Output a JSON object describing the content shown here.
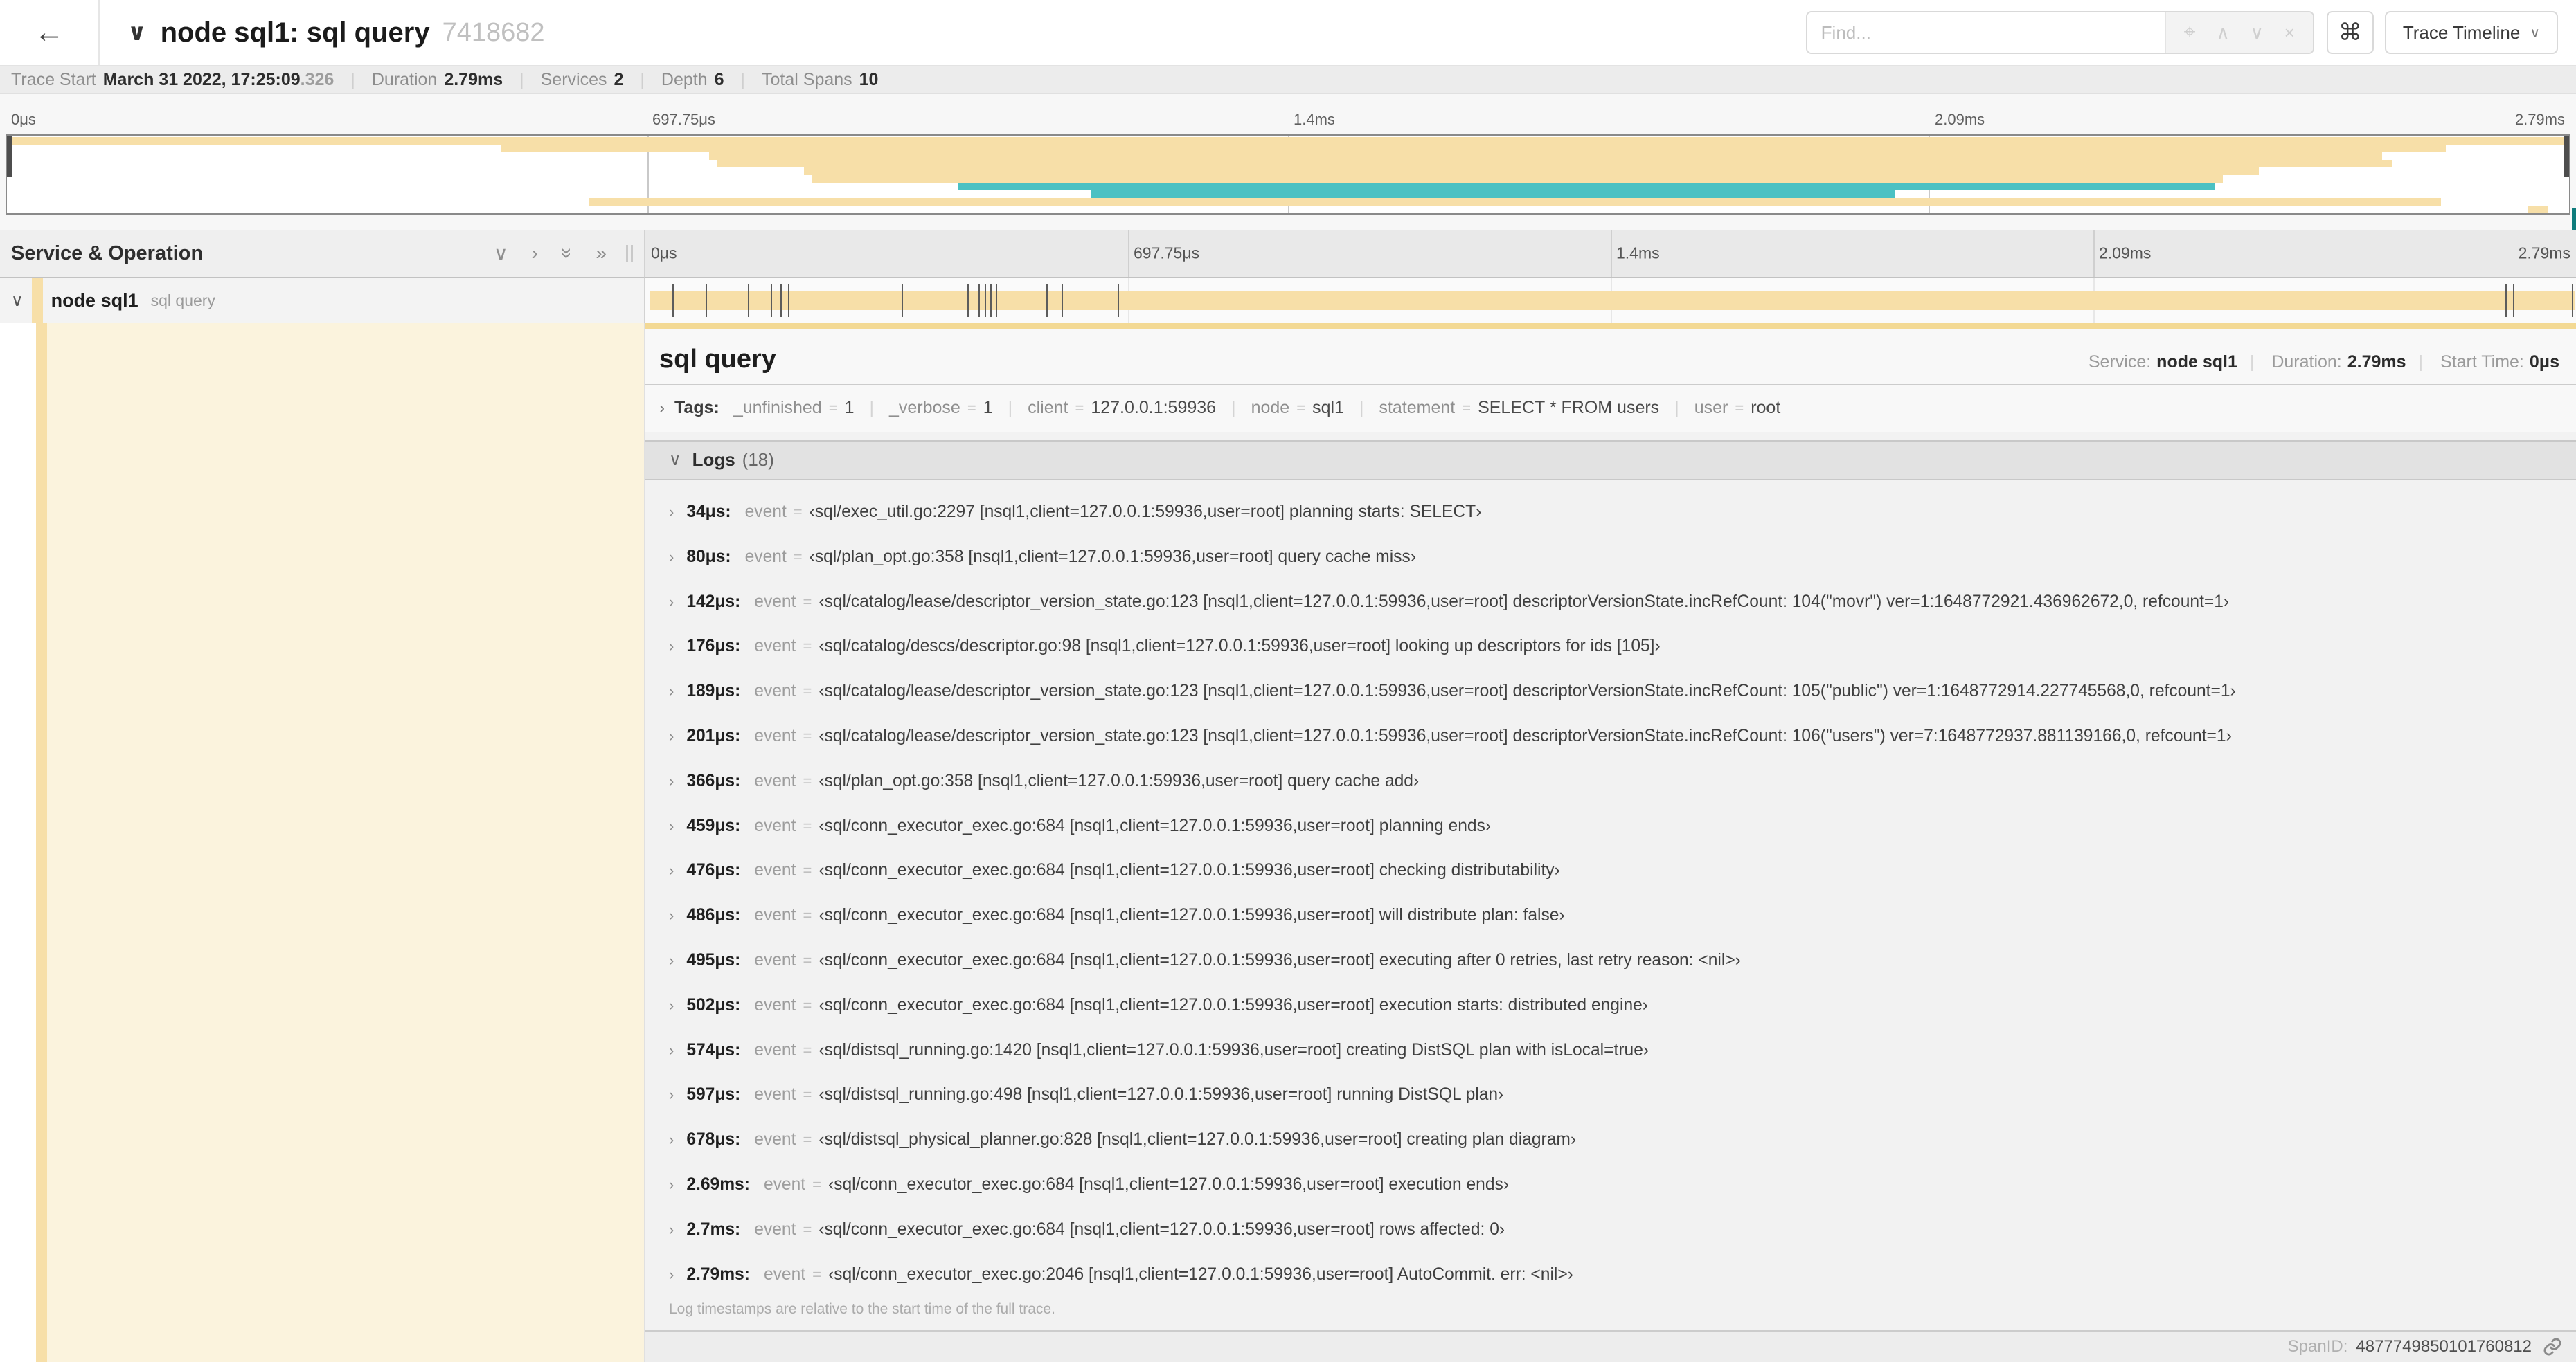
{
  "colors": {
    "span_tan": "#F7DFA8",
    "span_teal": "#4BC1C3",
    "accent_tan": "#F3D994",
    "cream": "#FBF3DD"
  },
  "header": {
    "back_icon": "←",
    "collapse_icon": "∨",
    "title": "node sql1: sql query",
    "trace_id": "7418682",
    "find_placeholder": "Find...",
    "focus_icon": "⌖",
    "prev_icon": "∧",
    "next_icon": "∨",
    "clear_icon": "×",
    "shortcut_button": "⌘",
    "view_button": "Trace Timeline",
    "view_button_chevron": "∨"
  },
  "trace_info": {
    "items": [
      {
        "label": "Trace Start",
        "value": "March 31 2022, 17:25:09",
        "suffix": ".326"
      },
      {
        "label": "Duration",
        "value": "2.79ms",
        "suffix": ""
      },
      {
        "label": "Services",
        "value": "2",
        "suffix": ""
      },
      {
        "label": "Depth",
        "value": "6",
        "suffix": ""
      },
      {
        "label": "Total Spans",
        "value": "10",
        "suffix": ""
      }
    ]
  },
  "ruler": {
    "ticks": [
      {
        "label": "0μs",
        "pct": 0
      },
      {
        "label": "697.75μs",
        "pct": 25
      },
      {
        "label": "1.4ms",
        "pct": 50
      },
      {
        "label": "2.09ms",
        "pct": 75
      },
      {
        "label": "2.79ms",
        "pct": 100
      }
    ]
  },
  "minimap": {
    "rows": [
      {
        "start": 0,
        "end": 100,
        "color": "tan"
      },
      {
        "start": 19.3,
        "end": 95.2,
        "color": "tan"
      },
      {
        "start": 27.4,
        "end": 92.7,
        "color": "tan"
      },
      {
        "start": 27.7,
        "end": 93.1,
        "color": "tan"
      },
      {
        "start": 31.1,
        "end": 87.9,
        "color": "tan"
      },
      {
        "start": 31.4,
        "end": 86.5,
        "color": "tan"
      },
      {
        "start": 37.1,
        "end": 86.2,
        "color": "teal"
      },
      {
        "start": 42.3,
        "end": 73.7,
        "color": "teal"
      },
      {
        "start": 22.7,
        "end": 95.0,
        "color": "tan"
      },
      {
        "start": 98.4,
        "end": 99.2,
        "color": "tan"
      }
    ]
  },
  "columns": {
    "title": "Service & Operation",
    "collapse_one_icon": "∨",
    "expand_one_icon": "›",
    "collapse_all_icon": "»",
    "expand_all_icon": "»"
  },
  "span_row": {
    "chevron": "∨",
    "service": "node sql1",
    "operation": "sql query"
  },
  "detail": {
    "title": "sql query",
    "meta": [
      {
        "label": "Service:",
        "value": "node sql1"
      },
      {
        "label": "Duration:",
        "value": "2.79ms"
      },
      {
        "label": "Start Time:",
        "value": "0μs"
      }
    ],
    "tags_chevron": "›",
    "tags_label": "Tags:",
    "tags": [
      {
        "key": "_unfinished",
        "value": "1"
      },
      {
        "key": "_verbose",
        "value": "1"
      },
      {
        "key": "client",
        "value": "127.0.0.1:59936"
      },
      {
        "key": "node",
        "value": "sql1"
      },
      {
        "key": "statement",
        "value": "SELECT * FROM users"
      },
      {
        "key": "user",
        "value": "root"
      }
    ],
    "logs_chevron": "∨",
    "logs_label": "Logs",
    "logs_count": "(18)",
    "log_field": "event",
    "logs": [
      {
        "t": "34μs:",
        "pct": 1.2,
        "msg": "‹sql/exec_util.go:2297 [nsql1,client=127.0.0.1:59936,user=root] planning starts: SELECT›"
      },
      {
        "t": "80μs:",
        "pct": 2.9,
        "msg": "‹sql/plan_opt.go:358 [nsql1,client=127.0.0.1:59936,user=root] query cache miss›"
      },
      {
        "t": "142μs:",
        "pct": 5.1,
        "msg": "‹sql/catalog/lease/descriptor_version_state.go:123 [nsql1,client=127.0.0.1:59936,user=root] descriptorVersionState.incRefCount: 104(\"movr\") ver=1:1648772921.436962672,0, refcount=1›"
      },
      {
        "t": "176μs:",
        "pct": 6.3,
        "msg": "‹sql/catalog/descs/descriptor.go:98 [nsql1,client=127.0.0.1:59936,user=root] looking up descriptors for ids [105]›"
      },
      {
        "t": "189μs:",
        "pct": 6.8,
        "msg": "‹sql/catalog/lease/descriptor_version_state.go:123 [nsql1,client=127.0.0.1:59936,user=root] descriptorVersionState.incRefCount: 105(\"public\") ver=1:1648772914.227745568,0, refcount=1›"
      },
      {
        "t": "201μs:",
        "pct": 7.2,
        "msg": "‹sql/catalog/lease/descriptor_version_state.go:123 [nsql1,client=127.0.0.1:59936,user=root] descriptorVersionState.incRefCount: 106(\"users\") ver=7:1648772937.881139166,0, refcount=1›"
      },
      {
        "t": "366μs:",
        "pct": 13.1,
        "msg": "‹sql/plan_opt.go:358 [nsql1,client=127.0.0.1:59936,user=root] query cache add›"
      },
      {
        "t": "459μs:",
        "pct": 16.5,
        "msg": "‹sql/conn_executor_exec.go:684 [nsql1,client=127.0.0.1:59936,user=root] planning ends›"
      },
      {
        "t": "476μs:",
        "pct": 17.1,
        "msg": "‹sql/conn_executor_exec.go:684 [nsql1,client=127.0.0.1:59936,user=root] checking distributability›"
      },
      {
        "t": "486μs:",
        "pct": 17.4,
        "msg": "‹sql/conn_executor_exec.go:684 [nsql1,client=127.0.0.1:59936,user=root] will distribute plan: false›"
      },
      {
        "t": "495μs:",
        "pct": 17.7,
        "msg": "‹sql/conn_executor_exec.go:684 [nsql1,client=127.0.0.1:59936,user=root] executing after 0 retries, last retry reason: <nil>›"
      },
      {
        "t": "502μs:",
        "pct": 18.0,
        "msg": "‹sql/conn_executor_exec.go:684 [nsql1,client=127.0.0.1:59936,user=root] execution starts: distributed engine›"
      },
      {
        "t": "574μs:",
        "pct": 20.6,
        "msg": "‹sql/distsql_running.go:1420 [nsql1,client=127.0.0.1:59936,user=root] creating DistSQL plan with isLocal=true›"
      },
      {
        "t": "597μs:",
        "pct": 21.4,
        "msg": "‹sql/distsql_running.go:498 [nsql1,client=127.0.0.1:59936,user=root] running DistSQL plan›"
      },
      {
        "t": "678μs:",
        "pct": 24.3,
        "msg": "‹sql/distsql_physical_planner.go:828 [nsql1,client=127.0.0.1:59936,user=root] creating plan diagram›"
      },
      {
        "t": "2.69ms:",
        "pct": 96.4,
        "msg": "‹sql/conn_executor_exec.go:684 [nsql1,client=127.0.0.1:59936,user=root] execution ends›"
      },
      {
        "t": "2.7ms:",
        "pct": 96.8,
        "msg": "‹sql/conn_executor_exec.go:684 [nsql1,client=127.0.0.1:59936,user=root] rows affected: 0›"
      },
      {
        "t": "2.79ms:",
        "pct": 100,
        "msg": "‹sql/conn_executor_exec.go:2046 [nsql1,client=127.0.0.1:59936,user=root] AutoCommit. err: <nil>›"
      }
    ],
    "note": "Log timestamps are relative to the start time of the full trace.",
    "span_id_label": "SpanID:",
    "span_id": "4877749850101760812"
  }
}
